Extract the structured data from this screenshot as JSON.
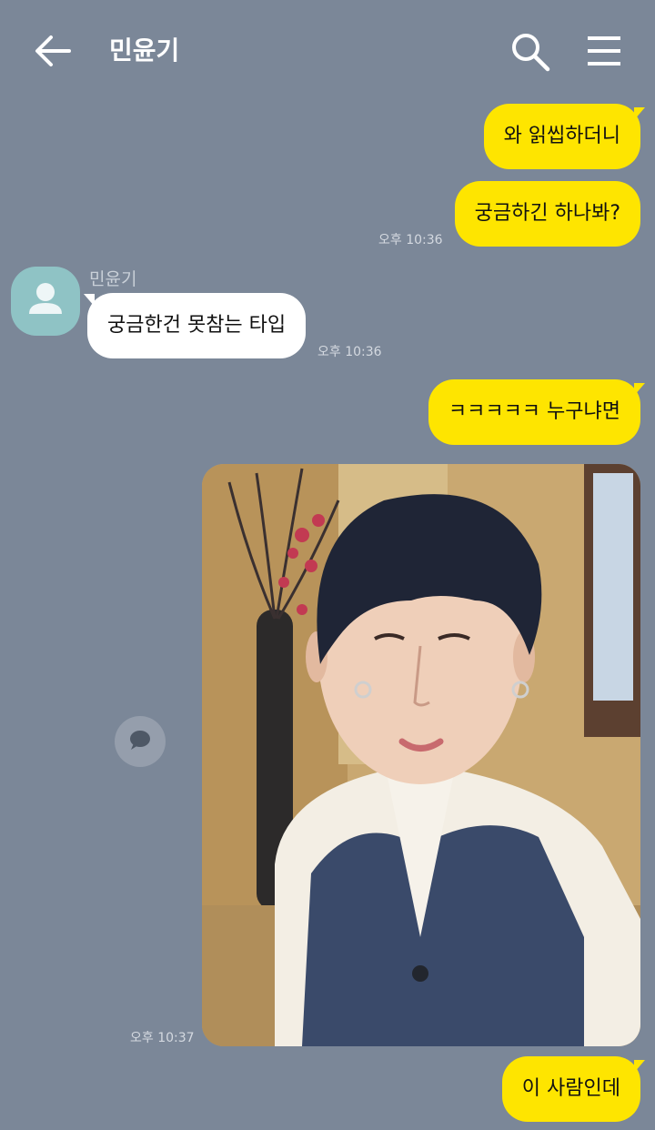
{
  "header": {
    "title": "민윤기",
    "back_icon": "arrow-left-icon",
    "search_icon": "search-icon",
    "menu_icon": "hamburger-menu-icon"
  },
  "messages": {
    "m1": "와 읽씹하더니",
    "m2": "궁금하긴 하나봐?",
    "t1": "오후 10:36",
    "sender": "민윤기",
    "m3": "궁금한건 못참는 타입",
    "t2": "오후 10:36",
    "m4": "ㅋㅋㅋㅋㅋ 누구냐면",
    "t3": "오후 10:37",
    "m5": "이 사람인데"
  },
  "colors": {
    "background": "#7B8798",
    "my_bubble": "#FEE500",
    "their_bubble": "#FFFFFF"
  }
}
